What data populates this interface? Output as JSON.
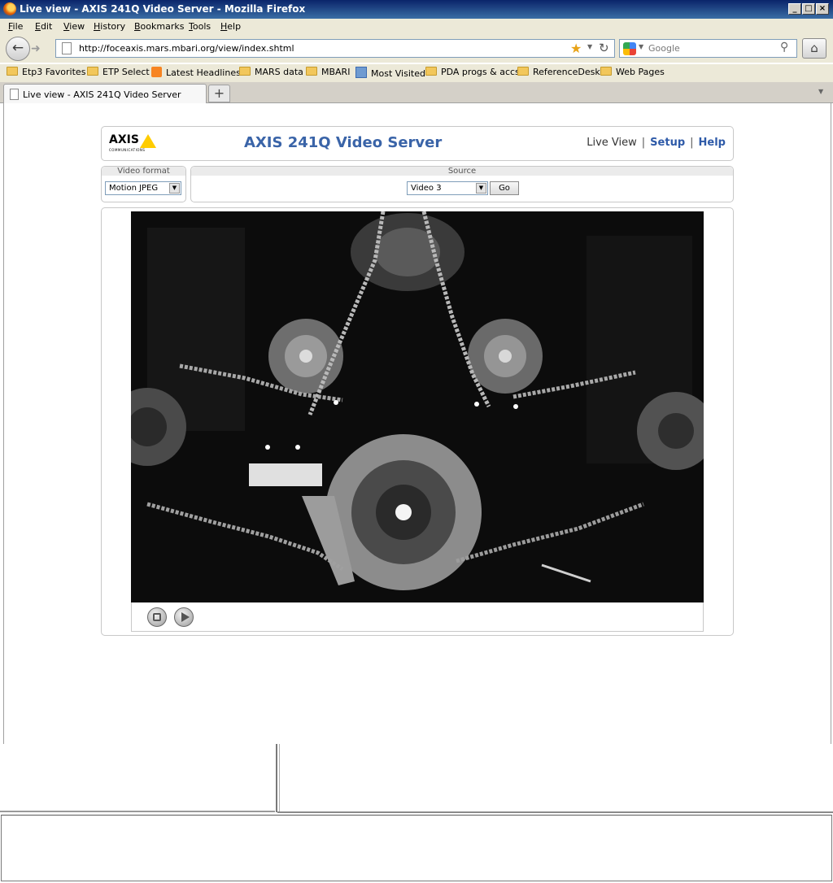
{
  "window": {
    "title": "Live view - AXIS 241Q Video Server - Mozilla Firefox",
    "controls": [
      "_",
      "□",
      "×"
    ]
  },
  "menu": [
    "File",
    "Edit",
    "View",
    "History",
    "Bookmarks",
    "Tools",
    "Help"
  ],
  "nav": {
    "url": "http://foceaxis.mars.mbari.org/view/index.shtml",
    "search_placeholder": "Google"
  },
  "bookmarks": [
    {
      "label": "Etp3 Favorites",
      "icon": "folder-icon"
    },
    {
      "label": "ETP Select",
      "icon": "folder-icon"
    },
    {
      "label": "Latest Headlines",
      "icon": "rss-icon"
    },
    {
      "label": "MARS data",
      "icon": "folder-icon"
    },
    {
      "label": "MBARI",
      "icon": "folder-icon"
    },
    {
      "label": "Most Visited",
      "icon": "most-visited-icon"
    },
    {
      "label": "PDA progs & accs",
      "icon": "folder-icon"
    },
    {
      "label": "ReferenceDesk",
      "icon": "folder-icon"
    },
    {
      "label": "Web Pages",
      "icon": "folder-icon"
    }
  ],
  "tab": {
    "label": "Live view - AXIS 241Q Video Server",
    "new_tab": "+"
  },
  "page": {
    "logo_text": "AXIS",
    "logo_sub": "COMMUNICATIONS",
    "product_title": "AXIS 241Q Video Server",
    "links": {
      "live_view": "Live View",
      "sep": "|",
      "setup": "Setup",
      "help": "Help"
    },
    "video_format": {
      "label": "Video format",
      "selected": "Motion JPEG"
    },
    "source": {
      "label": "Source",
      "selected": "Video 3",
      "go_label": "Go"
    }
  },
  "colors": {
    "accent_blue": "#3a64a8",
    "axis_yellow": "#ffcc00"
  }
}
